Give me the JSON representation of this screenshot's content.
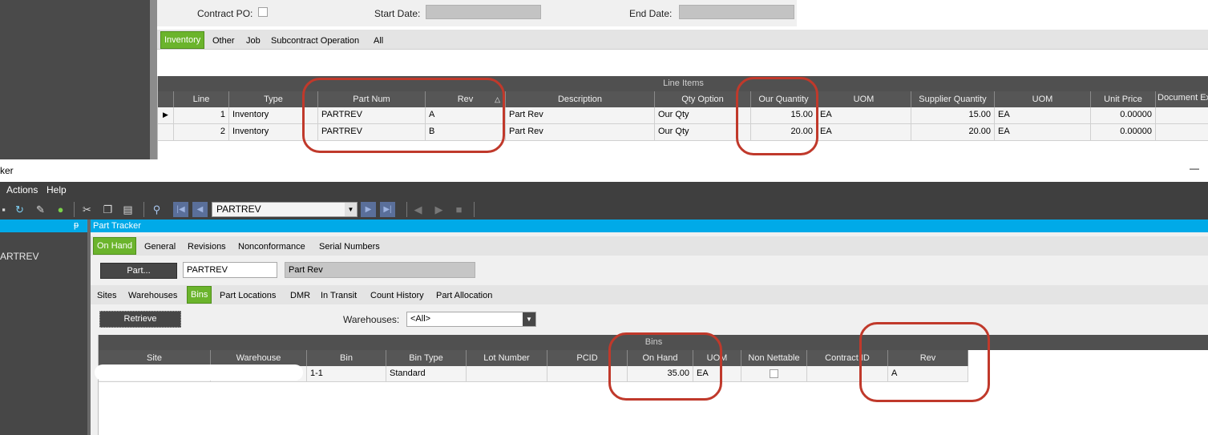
{
  "po_header": {
    "contract_po_label": "Contract PO:",
    "start_date_label": "Start Date:",
    "end_date_label": "End Date:"
  },
  "po_tabs": [
    "Inventory",
    "Other",
    "Job",
    "Subcontract Operation",
    "All"
  ],
  "line_items": {
    "title": "Line Items",
    "columns": [
      "Line",
      "Type",
      "Part Num",
      "Rev",
      "Description",
      "Qty Option",
      "Our Quantity",
      "UOM",
      "Supplier Quantity",
      "UOM",
      "Unit Price",
      "Document Ex"
    ],
    "rows": [
      [
        "1",
        "Inventory",
        "PARTREV",
        "A",
        "Part Rev",
        "Our Qty",
        "15.00",
        "EA",
        "15.00",
        "EA",
        "0.00000",
        ""
      ],
      [
        "2",
        "Inventory",
        "PARTREV",
        "B",
        "Part Rev",
        "Our Qty",
        "20.00",
        "EA",
        "20.00",
        "EA",
        "0.00000",
        ""
      ]
    ]
  },
  "window": {
    "title_fragment": "ker",
    "minimize_glyph": "—"
  },
  "menu": {
    "actions": "Actions",
    "help": "Help"
  },
  "toolbar": {
    "part_value": "PARTREV"
  },
  "left_pane": {
    "item": "ARTREV",
    "pin_glyph": "ᵽ"
  },
  "part_tracker": {
    "title": "Part Tracker",
    "tabs": [
      "On Hand",
      "General",
      "Revisions",
      "Nonconformance",
      "Serial Numbers"
    ],
    "part_button": "Part...",
    "part_value": "PARTREV",
    "part_desc": "Part Rev",
    "subtabs": [
      "Sites",
      "Warehouses",
      "Bins",
      "Part Locations",
      "DMR",
      "In Transit",
      "Count History",
      "Part Allocation"
    ],
    "retrieve_button": "Retrieve",
    "warehouses_label": "Warehouses:",
    "warehouses_value": "<All>"
  },
  "bins": {
    "title": "Bins",
    "columns": [
      "Site",
      "Warehouse",
      "Bin",
      "Bin Type",
      "Lot Number",
      "PCID",
      "On Hand",
      "UOM",
      "Non Nettable",
      "Contract ID",
      "Rev"
    ],
    "rows": [
      [
        "",
        "",
        "1-1",
        "Standard",
        "",
        "",
        "35.00",
        "EA",
        "",
        "",
        "A"
      ]
    ]
  },
  "colors": {
    "accent_green": "#6bb42c",
    "title_blue": "#00aae8",
    "annotation_red": "#c0392b"
  }
}
